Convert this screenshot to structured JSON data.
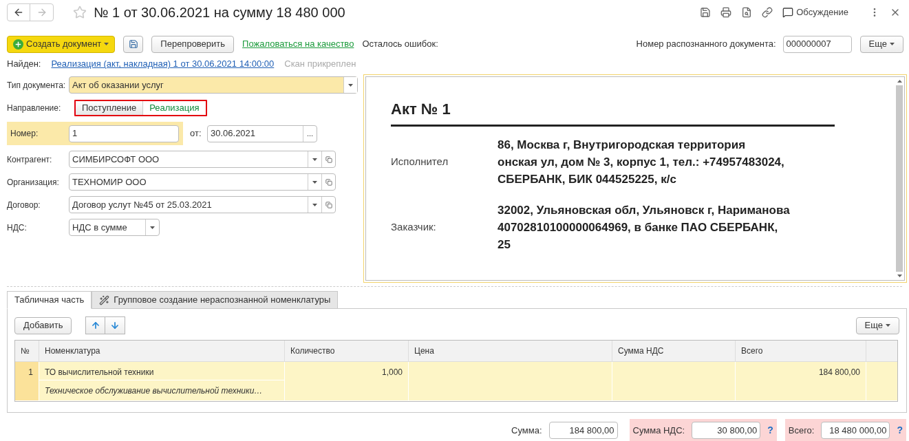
{
  "header": {
    "title": "№ 1 от 30.06.2021 на сумму 18 480 000",
    "discussion": "Обсуждение"
  },
  "toolbar": {
    "create": "Создать документ",
    "recheck": "Перепроверить",
    "complain": "Пожаловаться на качество",
    "errors_label": "Осталось ошибок:",
    "recognized_label": "Номер распознанного документа:",
    "recognized_value": "000000007",
    "more": "Еще"
  },
  "found": {
    "label": "Найден:",
    "link": "Реализация (акт, накладная) 1 от 30.06.2021 14:00:00",
    "scan": "Скан прикреплен"
  },
  "form": {
    "doc_type": {
      "label": "Тип документа:",
      "value": "Акт об оказании услуг"
    },
    "direction": {
      "label": "Направление:",
      "options": [
        {
          "label": "Поступление",
          "selected": false
        },
        {
          "label": "Реализация",
          "selected": true
        }
      ]
    },
    "number": {
      "label": "Номер:",
      "value": "1",
      "date_label": "от:",
      "date": "30.06.2021",
      "pick": "..."
    },
    "refs": [
      {
        "label": "Контрагент:",
        "value": "СИМБИРСОФТ ООО"
      },
      {
        "label": "Организация:",
        "value": "ТЕХНОМИР ООО"
      },
      {
        "label": "Договор:",
        "value": "Договор услут №45 от 25.03.2021"
      }
    ],
    "vat": {
      "label": "НДС:",
      "value": "НДС в сумме"
    }
  },
  "preview": {
    "title": "Акт № 1",
    "parties": [
      {
        "label": "Исполнител",
        "lines": [
          "86, Москва г, Внутригородская территория",
          "онская ул, дом № 3, корпус 1, тел.: +74957483024,",
          "СБЕРБАНК, БИК 044525225, к/с"
        ]
      },
      {
        "label": "Заказчик:",
        "lines": [
          "32002, Ульяновская обл, Ульяновск г, Нариманова",
          "40702810100000064969, в банке ПАО СБЕРБАНК,",
          "25"
        ]
      }
    ]
  },
  "tabs": [
    {
      "label": "Табличная часть",
      "selected": true
    },
    {
      "label": "Групповое создание нераспознанной номенклатуры",
      "selected": false
    }
  ],
  "table_toolbar": {
    "add": "Добавить",
    "more": "Еще"
  },
  "table": {
    "columns": [
      "№",
      "Номенклатура",
      "Количество",
      "Цена",
      "Сумма НДС",
      "Всего"
    ],
    "rows": [
      {
        "n": "1",
        "name": "ТО вычислительной техники",
        "description": "Техническое обслуживание вычислительной техники…",
        "quantity": "1,000",
        "total": "184 800,00",
        "selected": true
      }
    ]
  },
  "totals": [
    {
      "label": "Сумма:",
      "value": "184 800,00",
      "error": false
    },
    {
      "label": "Сумма НДС:",
      "value": "30 800,00",
      "error": true,
      "help": "?"
    },
    {
      "label": "Всего:",
      "value": "18 480 000,00",
      "error": true,
      "help": "?"
    }
  ]
}
